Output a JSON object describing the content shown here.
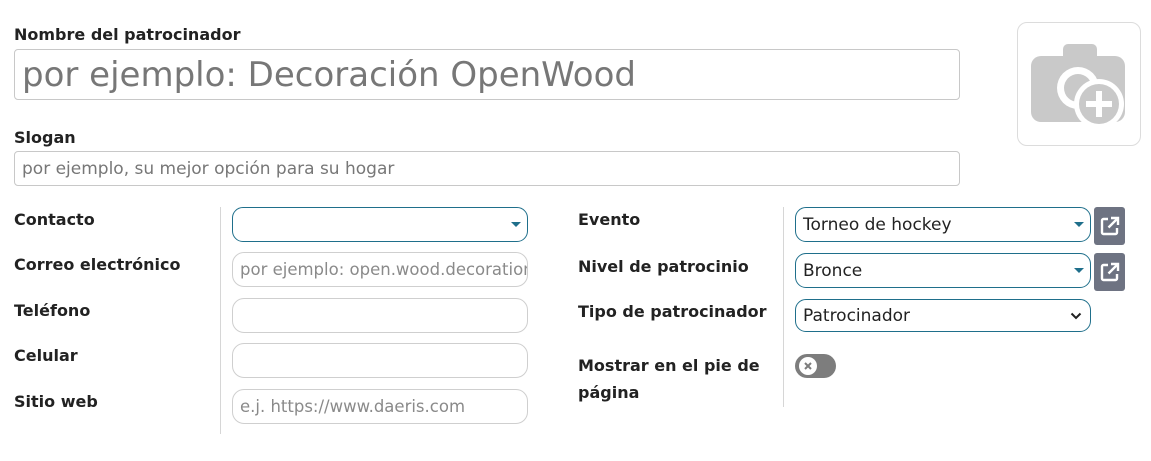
{
  "sponsor": {
    "name_label": "Nombre del patrocinador",
    "name_placeholder": "por ejemplo: Decoración OpenWood",
    "slogan_label": "Slogan",
    "slogan_placeholder": "por ejemplo, su mejor opción para su hogar"
  },
  "contact": {
    "contact_label": "Contacto",
    "contact_value": "",
    "email_label": "Correo electrónico",
    "email_placeholder": "por ejemplo: open.wood.decoration@example.com",
    "phone_label": "Teléfono",
    "mobile_label": "Celular",
    "website_label": "Sitio web",
    "website_placeholder": "e.j. https://www.daeris.com"
  },
  "event": {
    "event_label": "Evento",
    "event_value": "Torneo de hockey",
    "level_label": "Nivel de patrocinio",
    "level_value": "Bronce",
    "type_label": "Tipo de patrocinador",
    "type_value": "Patrocinador",
    "footer_label": "Mostrar en el pie de página",
    "footer_enabled": false
  },
  "icons": {
    "photo": "camera-plus-icon",
    "external_link": "external-link-icon",
    "dropdown": "caret-down-icon",
    "chevron": "chevron-down-icon",
    "toggle_off": "x-icon"
  },
  "colors": {
    "accent": "#1f6f8b",
    "button": "#6e7382",
    "toggle_off": "#7d7d7d"
  }
}
